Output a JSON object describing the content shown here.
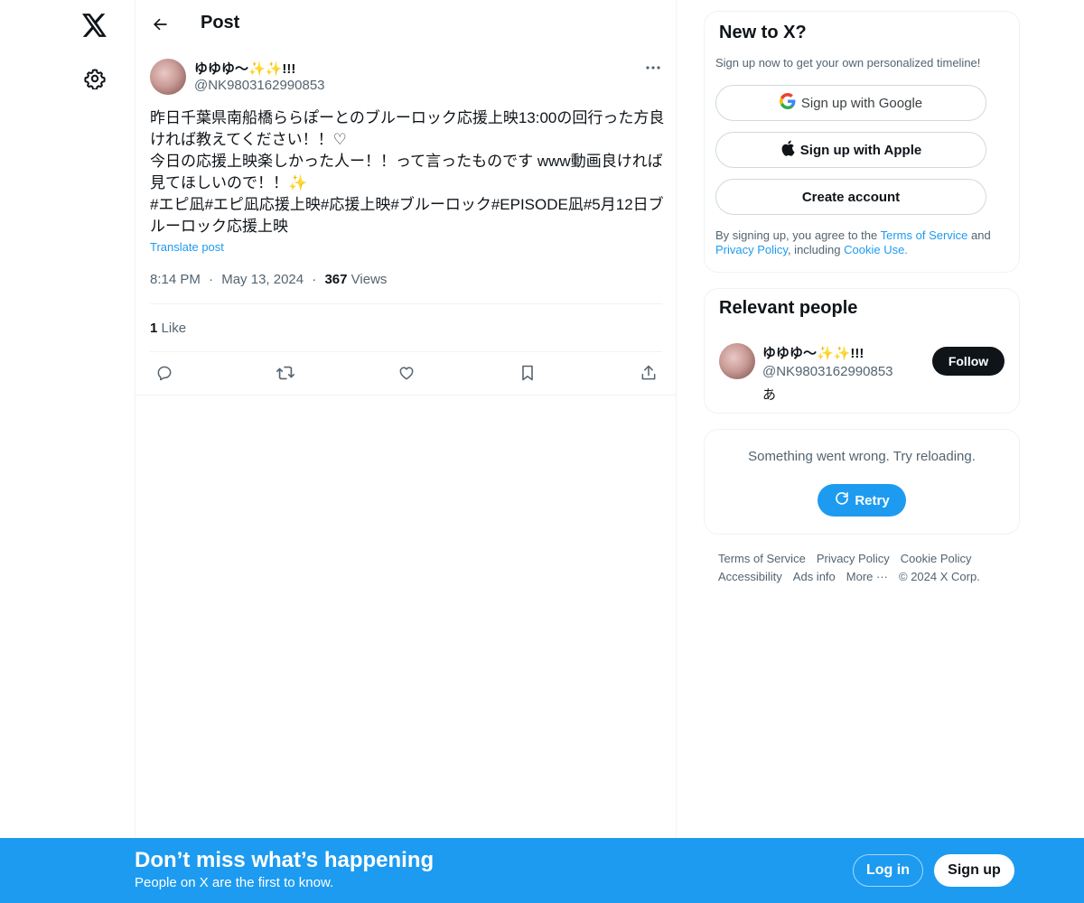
{
  "nav": {
    "logo_icon": "x-logo-icon",
    "settings_icon": "gear-icon"
  },
  "header": {
    "title": "Post",
    "back_icon": "arrow-left-icon"
  },
  "post": {
    "author_name": "ゆゆゆ～✨✨!!!",
    "author_handle": "@NK9803162990853",
    "more_icon": "more-horizontal-icon",
    "text": "昨日千葉県南船橋ららぽーとのブルーロック応援上映13:00の回行った方良ければ教えてください！！♡\n今日の応援上映楽しかった人ー！！って言ったものです www動画良ければ見てほしいので！！✨\n#エピ凪#エピ凪応援上映#応援上映#ブルーロック#EPISODE凪#5月12日ブルーロック応援上映",
    "translate_label": "Translate post",
    "time": "8:14 PM",
    "separator": "·",
    "date": "May 13, 2024",
    "views_count": "367",
    "views_label": "Views",
    "likes_count": "1",
    "likes_label": "Like"
  },
  "actions": [
    "reply-icon",
    "repost-icon",
    "like-icon",
    "bookmark-icon",
    "share-icon"
  ],
  "new_to_x": {
    "title": "New to X?",
    "subtitle": "Sign up now to get your own personalized timeline!",
    "google_label": "Sign up with Google",
    "apple_label": "Sign up with Apple",
    "create_label": "Create account",
    "legal_prefix": "By signing up, you agree to the ",
    "terms_link": "Terms of Service",
    "legal_and": " and ",
    "privacy_link": "Privacy Policy",
    "legal_including": ", including ",
    "cookie_link": "Cookie Use."
  },
  "relevant_people": {
    "title": "Relevant people",
    "name": "ゆゆゆ～✨✨!!!",
    "handle": "@NK9803162990853",
    "bio": "あ",
    "follow_label": "Follow"
  },
  "error_card": {
    "message": "Something went wrong. Try reloading.",
    "retry_label": "Retry"
  },
  "footer": {
    "terms": "Terms of Service",
    "privacy": "Privacy Policy",
    "cookie": "Cookie Policy",
    "accessibility": "Accessibility",
    "ads": "Ads info",
    "more": "More ···",
    "copyright": "© 2024 X Corp."
  },
  "banner": {
    "title": "Don’t miss what’s happening",
    "subtitle": "People on X are the first to know.",
    "login_label": "Log in",
    "signup_label": "Sign up"
  },
  "colors": {
    "accent": "#1d9bf0",
    "text": "#0f1419",
    "muted": "#536471",
    "border": "#eff3f4"
  }
}
